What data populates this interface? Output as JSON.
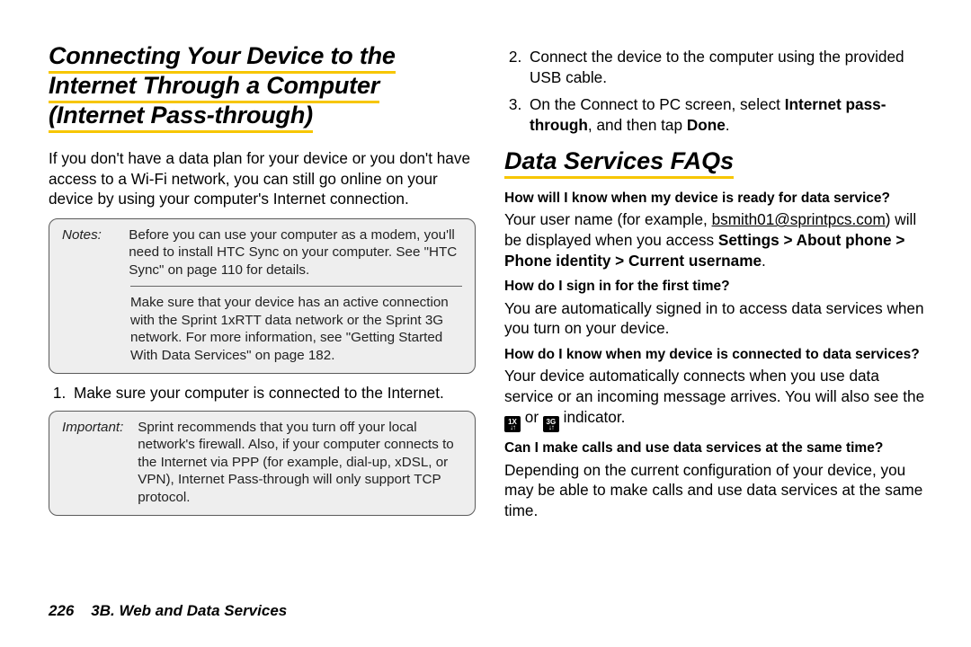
{
  "left": {
    "heading_l1": "Connecting Your Device to the",
    "heading_l2": "Internet Through a Computer",
    "heading_l3": "(Internet Pass-through)",
    "intro": "If you don't have a data plan for your device or you don't have access to a Wi-Fi network, you can still go online on your device by using your computer's Internet connection.",
    "notes_label": "Notes:",
    "notes_1": "Before you can use your computer as a modem, you'll need to install HTC Sync on your computer. See \"HTC Sync\" on page 110 for details.",
    "notes_2": "Make sure that your device has an active connection with the Sprint 1xRTT data network or the Sprint 3G network. For more information, see \"Getting Started With Data Services\" on page 182.",
    "step1": "Make sure your computer is connected to the Internet.",
    "important_label": "Important:",
    "important": "Sprint recommends that you turn off your local network's firewall. Also, if your computer connects to the Internet via PPP (for example, dial-up, xDSL, or VPN), Internet Pass-through will only support TCP protocol."
  },
  "right": {
    "step2": "Connect the device to the computer using the provided USB cable.",
    "step3_a": "On the Connect to PC screen, select ",
    "step3_b": "Internet pass-through",
    "step3_c": ", and then tap ",
    "step3_d": "Done",
    "step3_e": ".",
    "heading2": "Data Services FAQs",
    "q1": "How will I know when my device is ready for data service?",
    "a1_a": "Your user name (for example, ",
    "a1_email": "bsmith01@sprintpcs.com",
    "a1_b": ") will be displayed when you access ",
    "a1_c": "Settings > About phone > Phone identity > Current username",
    "a1_d": ".",
    "q2": "How do I sign in for the first time?",
    "a2": "You are automatically signed in to access data services when you turn on your device.",
    "q3": "How do I know when my device is connected to data services?",
    "a3_a": "Your device automatically connects when you use data service or an incoming message arrives. You will also see the ",
    "a3_or": " or ",
    "a3_b": " indicator.",
    "ind1_top": "1X",
    "ind2_top": "3G",
    "ind_arrows": "↓↑",
    "q4": "Can I make calls and use data services at the same time?",
    "a4": "Depending on the current configuration of your device, you may be able to make calls and use data services at the same time."
  },
  "footer": {
    "pagenum": "226",
    "section": "3B. Web and Data Services"
  }
}
